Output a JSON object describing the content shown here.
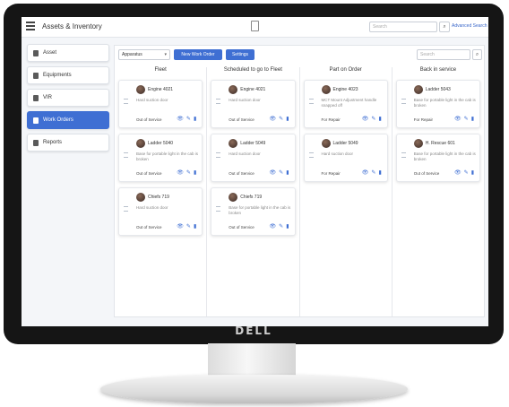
{
  "app": {
    "title": "Assets & Inventory",
    "search_placeholder": "Search",
    "advanced_search_label": "Advanced Search"
  },
  "device": {
    "brand": "DELL"
  },
  "sidebar": {
    "items": [
      {
        "label": "Asset",
        "active": false
      },
      {
        "label": "Equipments",
        "active": false
      },
      {
        "label": "VIR",
        "active": false
      },
      {
        "label": "Work Orders",
        "active": true
      },
      {
        "label": "Reports",
        "active": false
      }
    ]
  },
  "toolbar": {
    "select_value": "Apparatus",
    "new_work_order_label": "New Work Order",
    "settings_label": "Settings",
    "search_placeholder": "Search"
  },
  "board": {
    "columns": [
      {
        "title": "Fleet",
        "cards": [
          {
            "name": "Engine 4021",
            "desc": "Hard suction door",
            "status": "Out of Service"
          },
          {
            "name": "Ladder 5040",
            "desc": "Base for portable light in the cab is broken",
            "status": "Out of Service"
          },
          {
            "name": "Chiefs 719",
            "desc": "Hard suction door",
            "status": "Out of Service"
          }
        ]
      },
      {
        "title": "Scheduled to go to Fleet",
        "cards": [
          {
            "name": "Engine 4021",
            "desc": "Hard suction door",
            "status": "Out of Service"
          },
          {
            "name": "Ladder 5049",
            "desc": "Hard suction door",
            "status": "Out of Service"
          },
          {
            "name": "Chiefs 719",
            "desc": "Base for portable light in the cab is broken",
            "status": "Out of Service"
          }
        ]
      },
      {
        "title": "Part on Order",
        "cards": [
          {
            "name": "Engine 4023",
            "desc": "MCT Mount Adjustment handle snapped off",
            "status": "For Repair"
          },
          {
            "name": "Ladder 5049",
            "desc": "Hard suction door",
            "status": "For Repair"
          }
        ]
      },
      {
        "title": "Back in service",
        "cards": [
          {
            "name": "Ladder 5043",
            "desc": "Base for portable light in the cab is broken",
            "status": "For Repair"
          },
          {
            "name": "H. Rescue 601",
            "desc": "Base for portable light in the cab is broken",
            "status": "Out of Service"
          }
        ]
      }
    ]
  },
  "colors": {
    "accent": "#3f6fd3",
    "bezel": "#151515",
    "background": "#f4f6f9"
  },
  "icons": {
    "view": "eye-icon",
    "edit": "pencil-icon",
    "delete": "trash-icon"
  }
}
